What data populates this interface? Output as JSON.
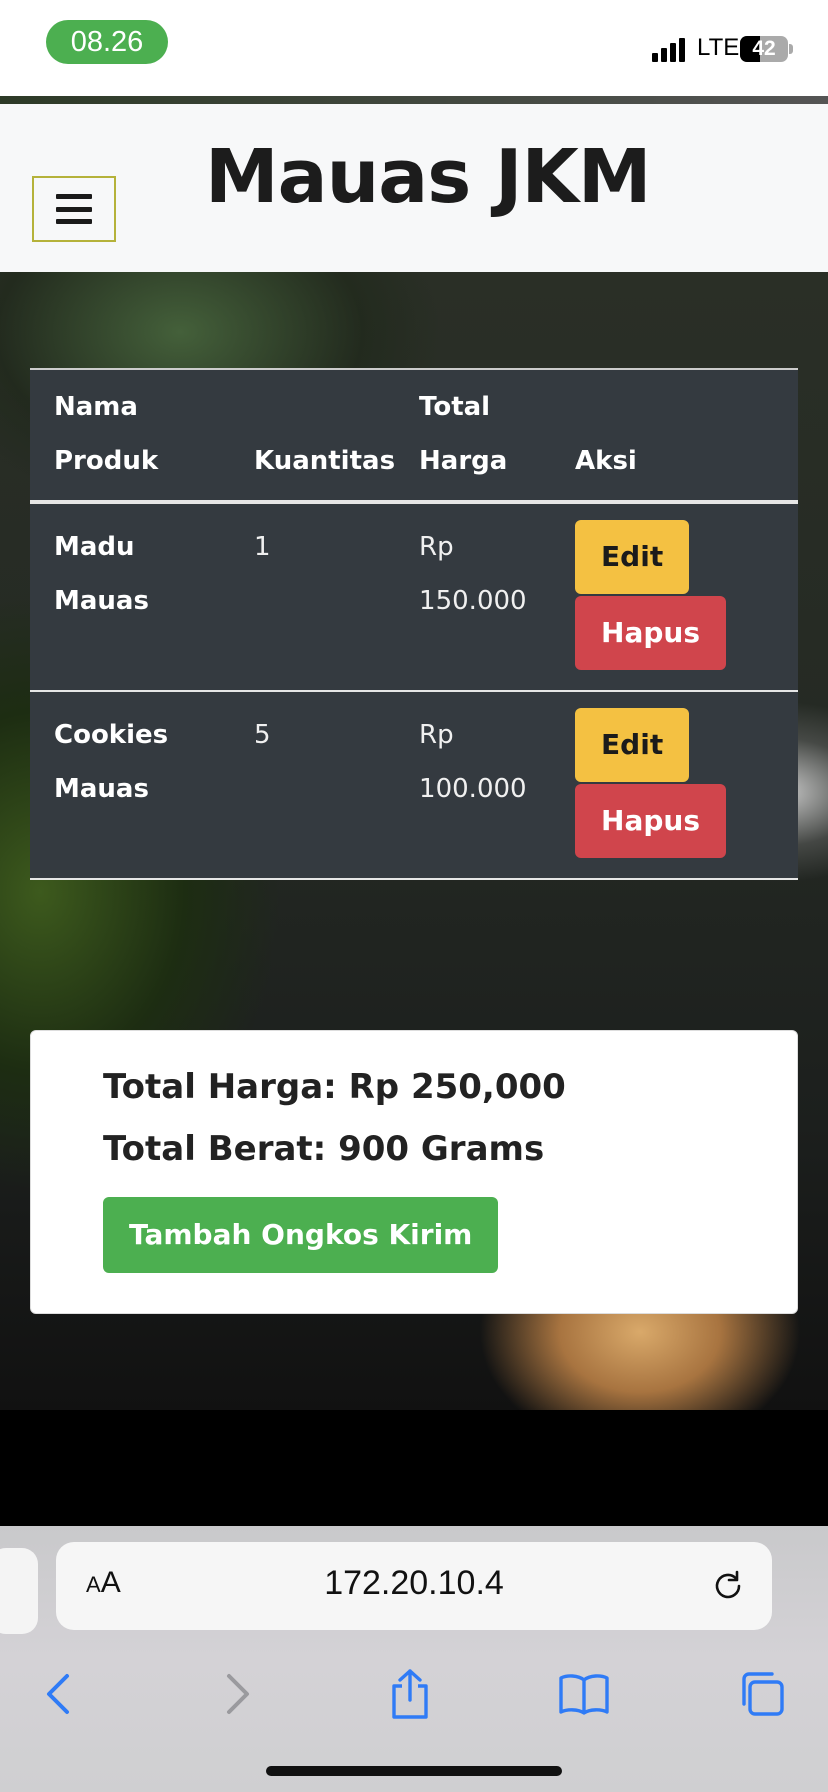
{
  "status_bar": {
    "time": "08.26",
    "network": "LTE",
    "battery_level": "42",
    "battery_fraction": 0.42
  },
  "header": {
    "title": "Mauas JKM",
    "menu_icon": "hamburger-icon"
  },
  "cart_table": {
    "columns": {
      "name_line1": "Nama",
      "name_line2": "Produk",
      "qty": "Kuantitas",
      "price_line1": "Total",
      "price_line2": "Harga",
      "action": "Aksi"
    },
    "rows": [
      {
        "name_line1": "Madu Mauas",
        "name_line2": "",
        "qty": "1",
        "price_line1": "Rp",
        "price_line2": "150.000",
        "edit_label": "Edit",
        "delete_label": "Hapus"
      },
      {
        "name_line1": "Cookies",
        "name_line2": "Mauas",
        "qty": "5",
        "price_line1": "Rp",
        "price_line2": "100.000",
        "edit_label": "Edit",
        "delete_label": "Hapus"
      }
    ]
  },
  "summary": {
    "total_price": "Total Harga: Rp 250,000",
    "total_weight": "Total Berat: 900 Grams",
    "shipping_button": "Tambah Ongkos Kirim"
  },
  "browser": {
    "text_size_label_big": "A",
    "text_size_label_small": "A",
    "url": "172.20.10.4",
    "icons": [
      "reload-icon",
      "back-icon",
      "forward-icon",
      "share-icon",
      "bookmarks-icon",
      "tabs-icon"
    ]
  },
  "colors": {
    "accent_green": "#4caf50",
    "edit_yellow": "#f4c142",
    "delete_red": "#d0454c",
    "table_dark": "#343a40"
  }
}
